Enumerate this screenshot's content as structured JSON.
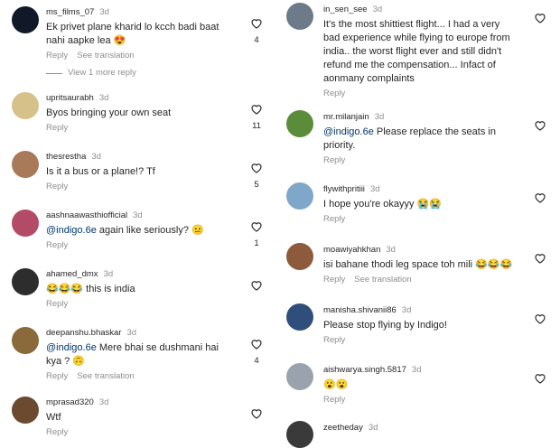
{
  "left": [
    {
      "user": "ms_films_07",
      "ago": "3d",
      "lines": [
        "Ek privet plane kharid lo kcch badi baat",
        "nahi aapke lea"
      ],
      "emoji": "😍",
      "likes": "4",
      "actions": [
        "Reply",
        "See translation"
      ],
      "more": "View 1 more reply"
    },
    {
      "user": "upritsaurabh",
      "ago": "3d",
      "lines": [
        "Byos bringing your own seat"
      ],
      "likes": "11",
      "actions": [
        "Reply"
      ]
    },
    {
      "user": "thesrestha",
      "ago": "3d",
      "lines": [
        "Is it a bus or a plane!? Tf"
      ],
      "likes": "5",
      "actions": [
        "Reply"
      ]
    },
    {
      "user": "aashnaawasthiofficial",
      "ago": "3d",
      "mention": "@indigo.6e",
      "lines": [
        "again like seriously? 😐"
      ],
      "likes": "1",
      "actions": [
        "Reply"
      ]
    },
    {
      "user": "ahamed_dmx",
      "ago": "3d",
      "lines": [
        "😂😂😂 this is india"
      ],
      "likes": "",
      "actions": [
        "Reply"
      ]
    },
    {
      "user": "deepanshu.bhaskar",
      "ago": "3d",
      "mention": "@indigo.6e",
      "lines": [
        "Mere bhai se dushmani hai",
        "kya ? 🙃"
      ],
      "likes": "4",
      "actions": [
        "Reply",
        "See translation"
      ]
    },
    {
      "user": "mprasad320",
      "ago": "3d",
      "lines": [
        "Wtf"
      ],
      "likes": "",
      "actions": [
        "Reply"
      ]
    }
  ],
  "right": [
    {
      "user": "in_sen_see",
      "ago": "3d",
      "lines": [
        "It's the most shittiest flight... I had a very",
        "bad experience while flying to europe from",
        "india.. the worst flight ever and still didn't",
        "refund me the compensation... Infact of",
        "aonmany complaints"
      ],
      "actions": [
        "Reply"
      ]
    },
    {
      "user": "mr.milanjain",
      "ago": "3d",
      "mention": "@indigo.6e",
      "lines": [
        "Please replace the seats in",
        "priority."
      ],
      "actions": [
        "Reply"
      ]
    },
    {
      "user": "flywithpritiii",
      "ago": "3d",
      "lines": [
        "I hope you're okayyy 😭😭"
      ],
      "actions": [
        "Reply"
      ]
    },
    {
      "user": "moawiyahkhan",
      "ago": "3d",
      "lines": [
        "isi bahane thodi leg space toh mili 😂😂😂"
      ],
      "actions": [
        "Reply",
        "See translation"
      ]
    },
    {
      "user": "manisha.shivanii86",
      "ago": "3d",
      "lines": [
        "Please stop flying by Indigo!"
      ],
      "actions": [
        "Reply"
      ]
    },
    {
      "user": "aishwarya.singh.5817",
      "ago": "3d",
      "lines": [
        "😮😮"
      ],
      "actions": [
        "Reply"
      ]
    },
    {
      "user": "zeetheday",
      "ago": "3d",
      "lines": [],
      "actions": []
    }
  ],
  "colors": {
    "text": "#262626",
    "muted": "#8e8e8e",
    "mention": "#00376b"
  },
  "icons": {
    "like": "heart-outline-icon"
  }
}
